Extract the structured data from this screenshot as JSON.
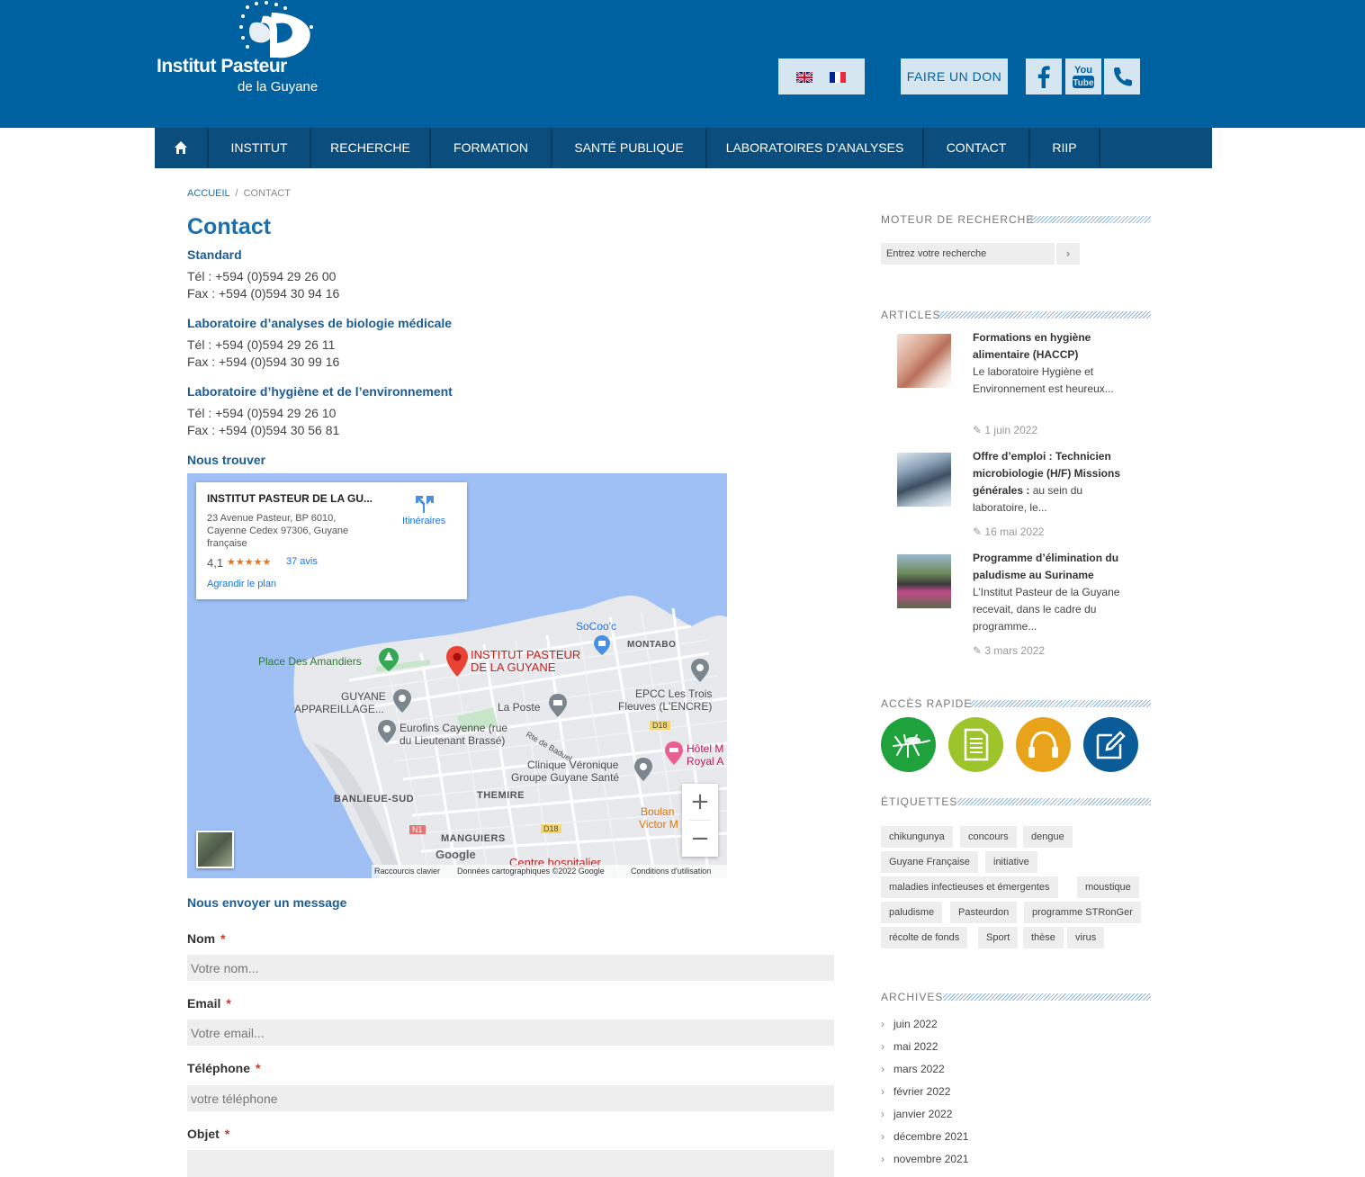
{
  "header": {
    "logo_line1": "Institut Pasteur",
    "logo_line2": "de la Guyane",
    "donate_label": "FAIRE UN DON",
    "brand_color": "#0061a1"
  },
  "nav": {
    "items": [
      "INSTITUT",
      "RECHERCHE",
      "FORMATION",
      "SANTÉ PUBLIQUE",
      "LABORATOIRES D’ANALYSES",
      "CONTACT",
      "RIIP"
    ]
  },
  "breadcrumb": {
    "home": "ACCUEIL",
    "sep": "/",
    "current": "CONTACT"
  },
  "page_title": "Contact",
  "contacts": [
    {
      "title": "Standard",
      "tel": "Tél : +594 (0)594 29 26 00",
      "fax": "Fax : +594 (0)594 30 94 16"
    },
    {
      "title": "Laboratoire d’analyses de biologie médicale",
      "tel": "Tél : +594 (0)594 29 26 11",
      "fax": "Fax : +594 (0)594 30 99 16"
    },
    {
      "title": "Laboratoire d’hygiène et de l’environnement",
      "tel": "Tél : +594 (0)594 29 26 10",
      "fax": "Fax : +594 (0)594 30 56 81"
    }
  ],
  "find_us": "Nous trouver",
  "map": {
    "card_title": "INSTITUT PASTEUR DE LA GU...",
    "address_line1": "23 Avenue Pasteur, BP 6010,",
    "address_line2": "Cayenne Cedex 97306, Guyane",
    "address_line3": "française",
    "rating": "4,1",
    "stars": "★★★★★",
    "reviews": "37 avis",
    "enlarge": "Agrandir le plan",
    "directions": "Itinéraires",
    "labels": {
      "socooc": "SoCoo'c",
      "montabo": "MONTABO",
      "place": "Place Des Amandiers",
      "pin1": "INSTITUT PASTEUR",
      "pin2": "DE LA GUYANE",
      "guyane1": "GUYANE",
      "guyane2": "APPAREILLAGE...",
      "epcc1": "EPCC Les Trois",
      "epcc2": "Fleuves (L'ENCRE)",
      "laposte": "La Poste",
      "eurofins1": "Eurofins Cayenne (rue",
      "eurofins2": "du Lieutenant Brassé)",
      "rue": "Rte de Baduel",
      "d18a": "D18",
      "hotel1": "Hôtel M",
      "hotel2": "Royal A",
      "clinique1": "Clinique Véronique",
      "clinique2": "Groupe Guyane Santé",
      "banlieue": "BANLIEUE-SUD",
      "themire": "THEMIRE",
      "boulan1": "Boulan",
      "boulan2": "Victor M",
      "n1": "N1",
      "d18b": "D18",
      "manguiers": "MANGUIERS",
      "google": "Google",
      "centre": "Centre hospitalier"
    },
    "footer": {
      "shortcuts": "Raccourcis clavier",
      "data": "Données cartographiques ©2022 Google",
      "terms": "Conditions d'utilisation"
    },
    "zoom_in": "+",
    "zoom_out": "−"
  },
  "form": {
    "title": "Nous envoyer un message",
    "required": "*",
    "fields": [
      {
        "label": "Nom",
        "placeholder": "Votre nom..."
      },
      {
        "label": "Email",
        "placeholder": "Votre email..."
      },
      {
        "label": "Téléphone",
        "placeholder": "votre téléphone"
      },
      {
        "label": "Objet",
        "placeholder": ""
      }
    ]
  },
  "sidebar": {
    "search_title": "MOTEUR DE RECHERCHE",
    "search_placeholder": "Entrez votre recherche",
    "search_arrow": "›",
    "articles_title": "ARTICLES",
    "articles": [
      {
        "title": "Formations en hygiène alimentaire (HACCP)",
        "excerpt": "Le laboratoire Hygiène et Environnement est heureux...",
        "date": "1 juin 2022"
      },
      {
        "title": "Offre d’emploi : Technicien microbiologie (H/F) Missions générales :",
        "excerpt": "au sein du laboratoire, le...",
        "date": "16 mai 2022"
      },
      {
        "title": "Programme d’élimination du paludisme au Suriname",
        "excerpt": "L’Institut Pasteur de la Guyane recevait, dans le cadre du programme...",
        "date": "3 mars 2022"
      }
    ],
    "quick_title": "ACCÈS RAPIDE",
    "quick_colors": [
      "#1fa13c",
      "#9dc42a",
      "#e8a31a",
      "#0a5c99"
    ],
    "tags_title": "ÉTIQUETTES",
    "tags": [
      "chikungunya",
      "concours",
      "dengue",
      "Guyane Française",
      "initiative",
      "maladies infectieuses et émergentes",
      "moustique",
      "paludisme",
      "Pasteurdon",
      "programme STRonGer",
      "récolte de fonds",
      "Sport",
      "thèse",
      "virus"
    ],
    "archives_title": "ARCHIVES",
    "archives": [
      "juin 2022",
      "mai 2022",
      "mars 2022",
      "février 2022",
      "janvier 2022",
      "décembre 2021",
      "novembre 2021"
    ]
  }
}
